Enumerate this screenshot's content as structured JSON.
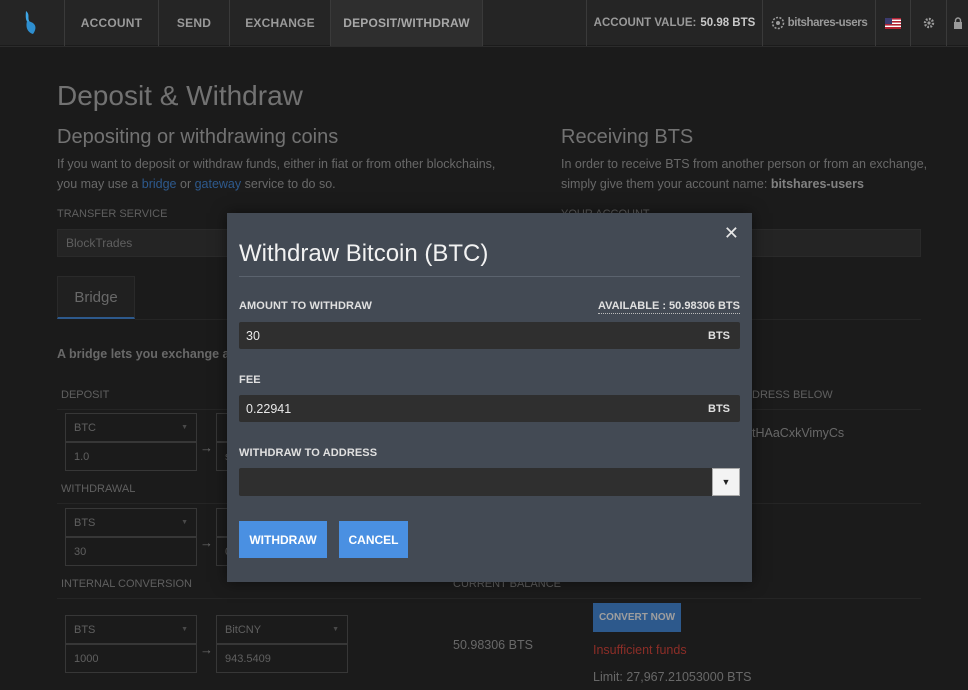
{
  "nav": {
    "tabs": [
      "ACCOUNT",
      "SEND",
      "EXCHANGE",
      "DEPOSIT/WITHDRAW"
    ],
    "account_value_label": "ACCOUNT VALUE:",
    "account_value": "50.98 BTS",
    "account_name": "bitshares-users"
  },
  "page": {
    "title": "Deposit & Withdraw",
    "left": {
      "heading": "Depositing or withdrawing coins",
      "text1": "If you want to deposit or withdraw funds, either in fiat or from other blockchains,",
      "text2_pre": "you may use a ",
      "link_bridge": "bridge",
      "text2_mid": " or ",
      "link_gateway": "gateway",
      "text2_post": " service to do so.",
      "transfer_service_label": "TRANSFER SERVICE",
      "transfer_service_value": "BlockTrades",
      "bridge_tab": "Bridge",
      "bridge_text": "A bridge lets you exchange a"
    },
    "right": {
      "heading": "Receiving BTS",
      "text1": "In order to receive BTS from another person or from an exchange,",
      "text2_pre": "simply give them your account name: ",
      "account_name": "bitshares-users",
      "your_account_label": "YOUR ACCOUNT"
    },
    "table": {
      "deposit_label": "DEPOSIT",
      "deposit_from": "BTC",
      "deposit_amount": "1.0",
      "deposit_to_partial": "s",
      "address_below_label": "DRESS BELOW",
      "address_partial": "tHAaCxkVimyCs",
      "withdrawal_label": "WITHDRAWAL",
      "withdraw_from": "BTS",
      "withdraw_amount": "30",
      "withdraw_to_partial": "0",
      "internal_label": "INTERNAL CONVERSION",
      "current_balance_label": "CURRENT BALANCE",
      "conv_from": "BTS",
      "conv_to": "BitCNY",
      "conv_amount": "1000",
      "conv_result": "943.5409",
      "current_balance": "50.98306 BTS",
      "convert_button": "CONVERT NOW",
      "insufficient": "Insufficient funds",
      "limit": "Limit: 27,967.21053000 BTS"
    }
  },
  "modal": {
    "title": "Withdraw Bitcoin (BTC)",
    "amount_label": "AMOUNT TO WITHDRAW",
    "available": "AVAILABLE : 50.98306 BTS",
    "amount_value": "30",
    "amount_unit": "BTS",
    "fee_label": "FEE",
    "fee_value": "0.22941",
    "fee_unit": "BTS",
    "address_label": "WITHDRAW TO ADDRESS",
    "withdraw_button": "WITHDRAW",
    "cancel_button": "CANCEL"
  },
  "colors": {
    "accent": "#4a90e2",
    "error": "#c0392b",
    "modal_bg": "#434a54"
  },
  "icons": [
    "bitshares-logo-icon",
    "account-users-icon",
    "us-flag-icon",
    "gear-icon",
    "lock-icon",
    "close-icon",
    "chevron-down-icon",
    "arrow-right-icon"
  ]
}
